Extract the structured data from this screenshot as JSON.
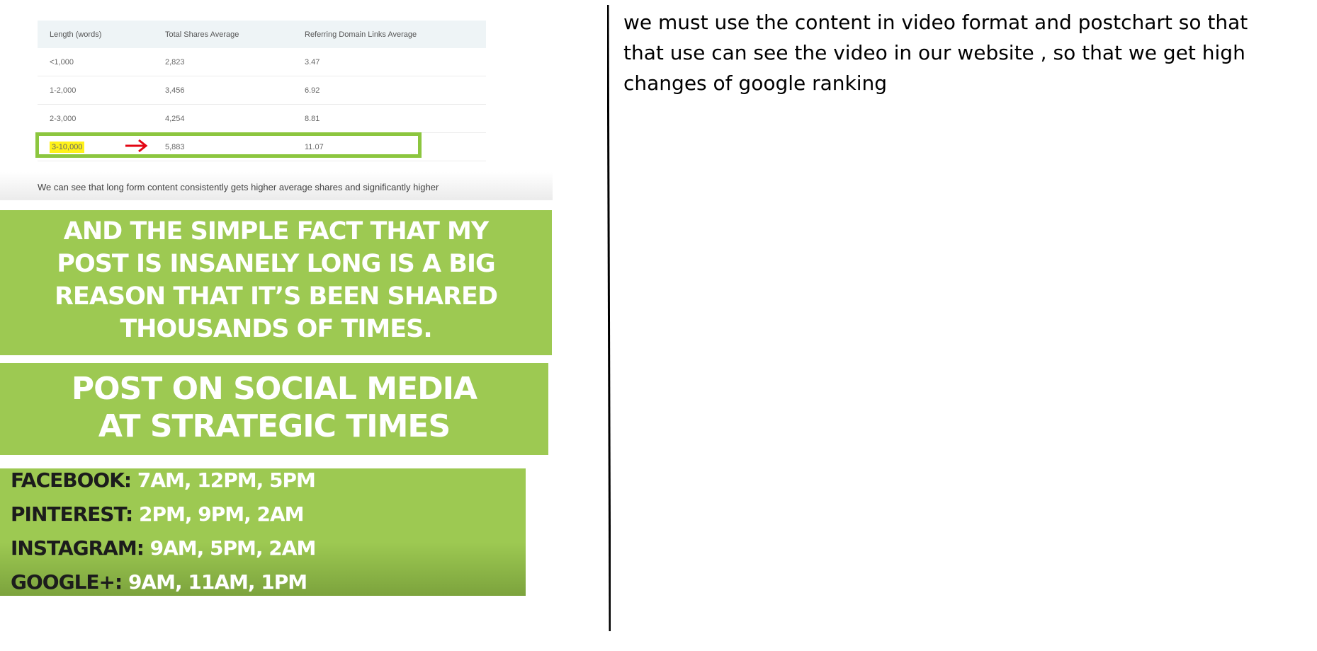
{
  "table": {
    "headers": [
      "Length (words)",
      "Total Shares Average",
      "Referring Domain Links Average"
    ],
    "rows": [
      [
        "<1,000",
        "2,823",
        "3.47"
      ],
      [
        "1-2,000",
        "3,456",
        "6.92"
      ],
      [
        "2-3,000",
        "4,254",
        "8.81"
      ],
      [
        "3-10,000",
        "5,883",
        "11.07"
      ]
    ],
    "highlight_color": "#fff21a",
    "box_color": "#8cc63f",
    "arrow_color": "#e30613",
    "caption": "We can see that long form content consistently gets higher average shares and significantly higher"
  },
  "banner_1": {
    "lines": [
      "AND THE SIMPLE FACT THAT MY",
      "POST IS INSANELY LONG IS A BIG",
      "REASON THAT IT’S BEEN SHARED",
      "THOUSANDS OF TIMES."
    ]
  },
  "banner_2": {
    "lines": [
      "POST ON SOCIAL MEDIA",
      "AT STRATEGIC TIMES"
    ]
  },
  "schedule": [
    {
      "platform": "FACEBOOK:",
      "times": "7AM, 12PM, 5PM"
    },
    {
      "platform": "PINTEREST:",
      "times": "2PM, 9PM, 2AM"
    },
    {
      "platform": "INSTAGRAM:",
      "times": "9AM, 5PM, 2AM"
    },
    {
      "platform": "GOOGLE+:",
      "times": "9AM, 11AM, 1PM"
    }
  ],
  "colors": {
    "banner_green": "#9dc952",
    "divider": "#000000"
  },
  "note": {
    "text": "we must use the content in video format and postchart so that that use can see the video in our website , so that we get high changes of google ranking"
  }
}
